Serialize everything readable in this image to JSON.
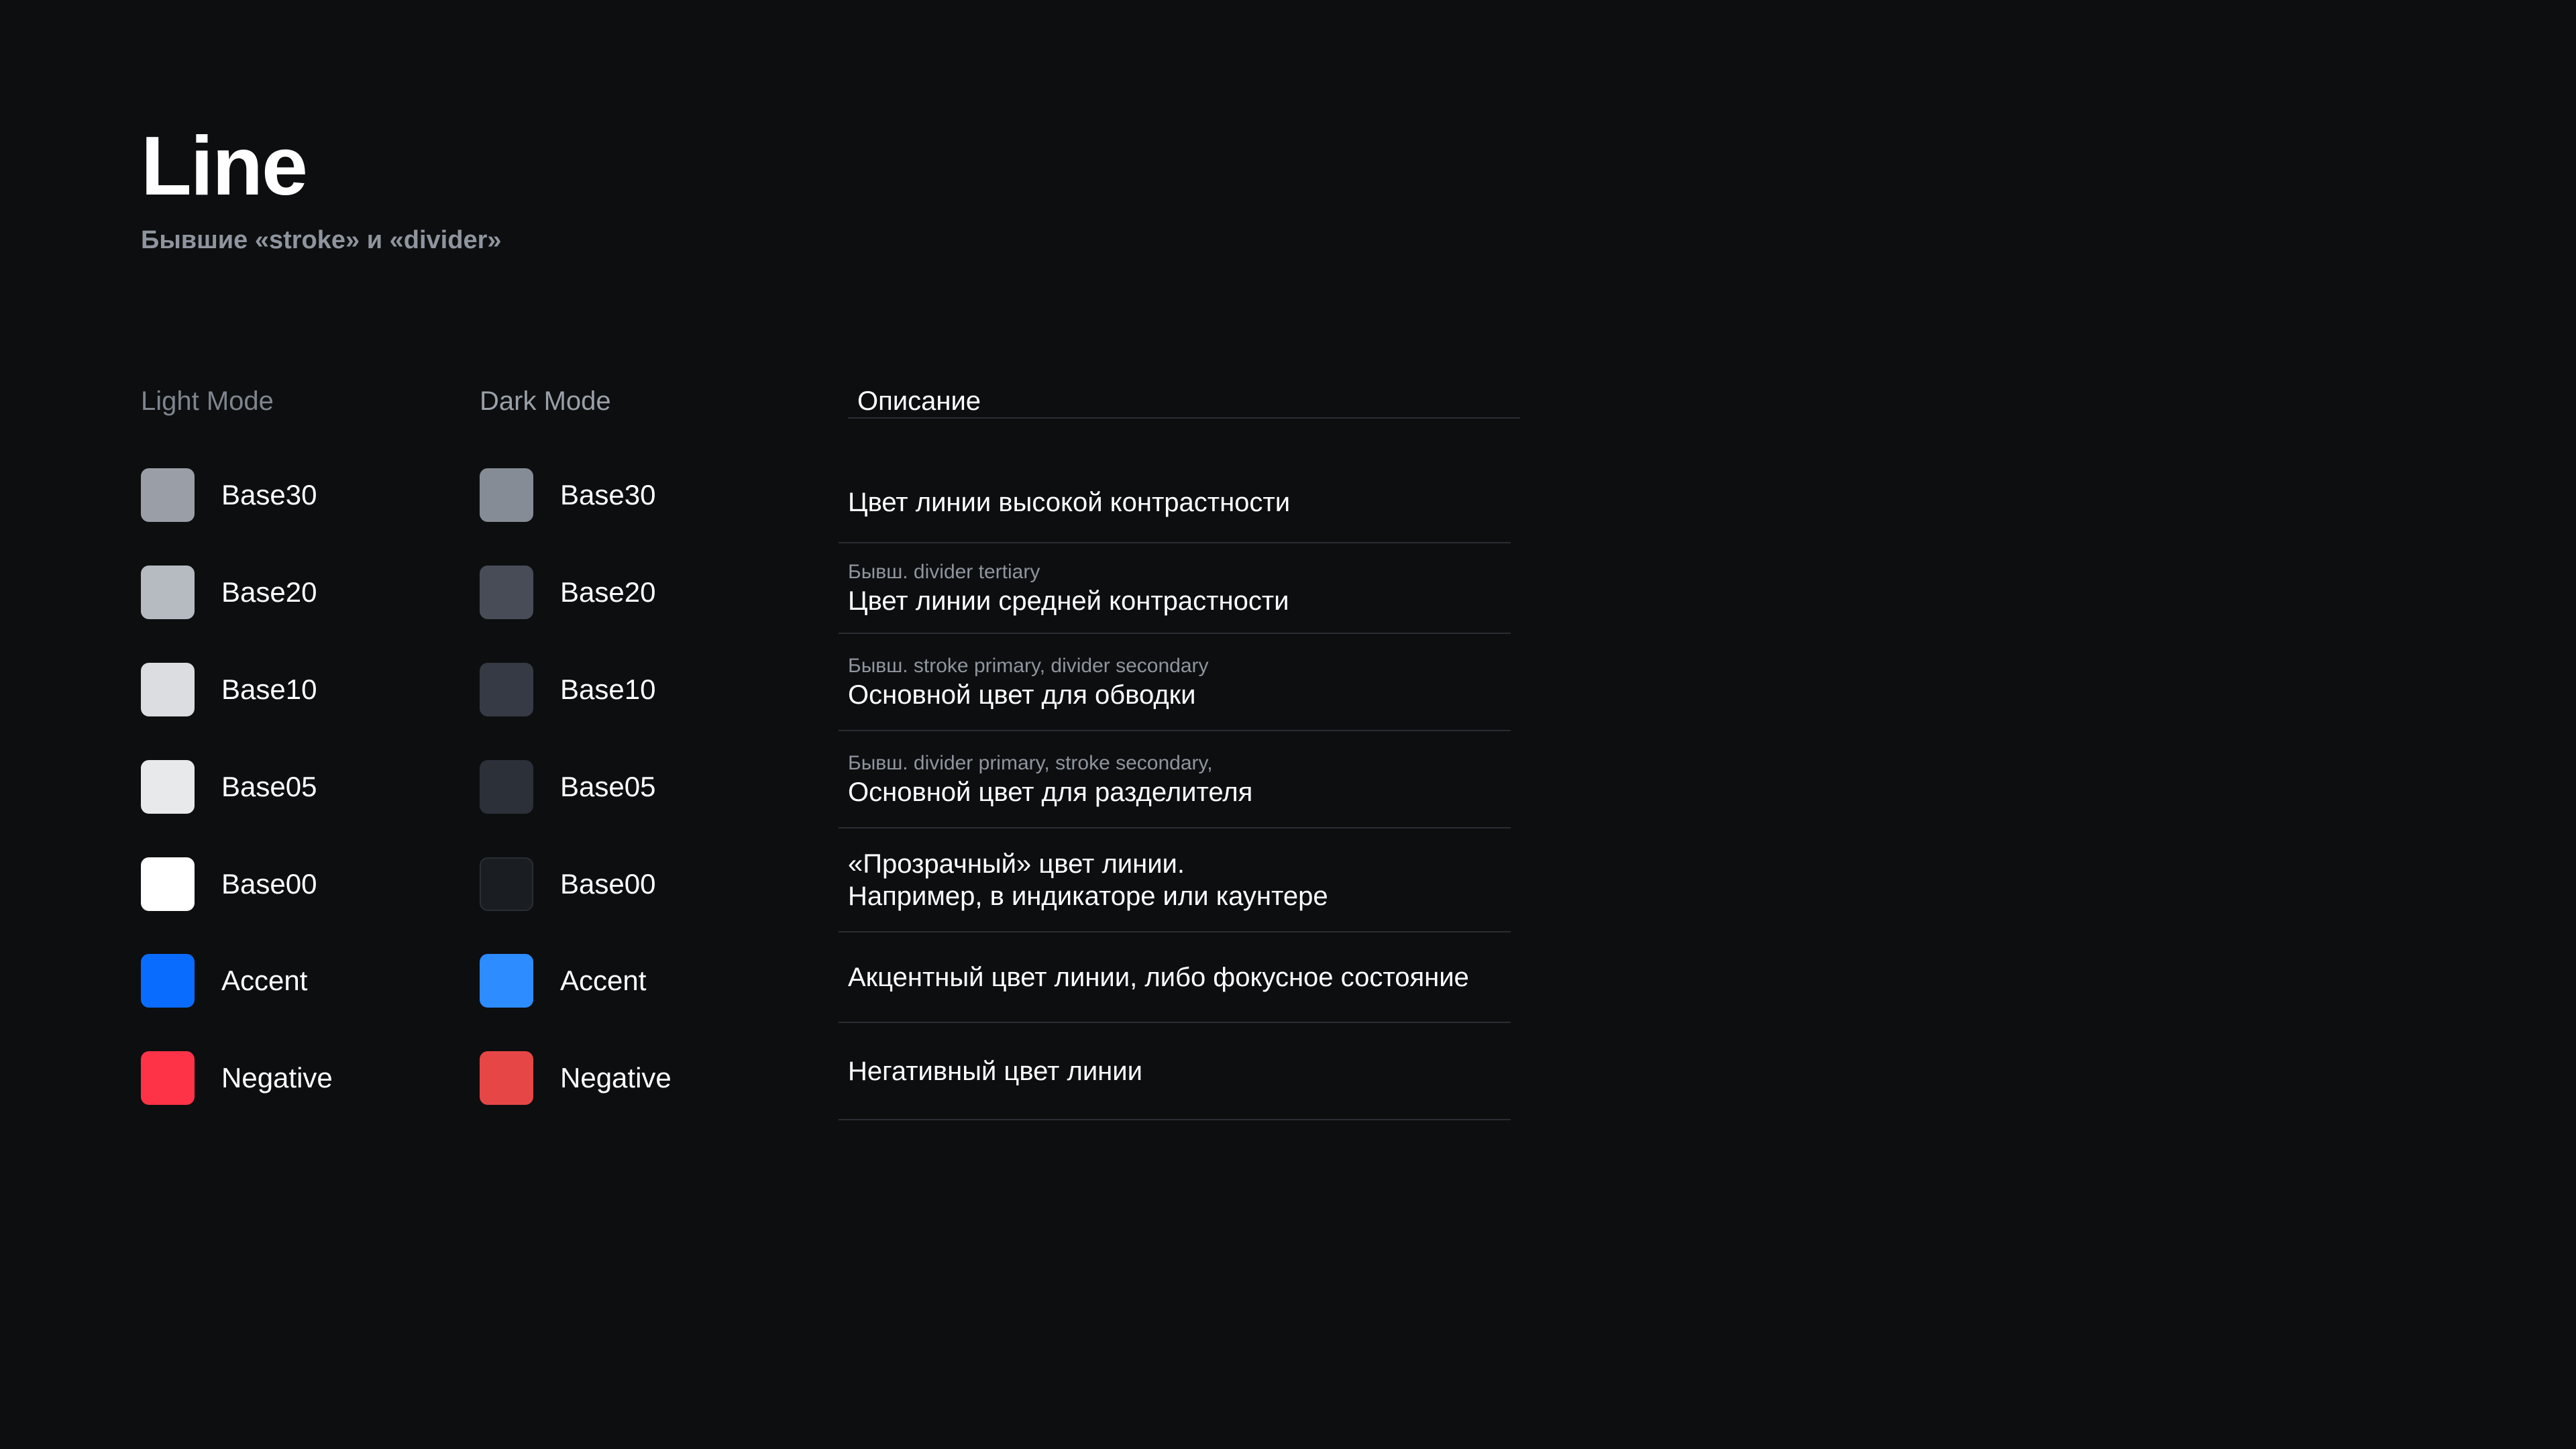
{
  "header": {
    "title": "Line",
    "subtitle": "Бывшие «stroke» и «divider»"
  },
  "columns": {
    "light": "Light Mode",
    "dark": "Dark Mode",
    "description": "Описание"
  },
  "rows": [
    {
      "light": {
        "label": "Base30",
        "color": "#9a9fa7"
      },
      "dark": {
        "label": "Base30",
        "color": "#868c95"
      },
      "former": "",
      "description": "Цвет линии высокой контрастности"
    },
    {
      "light": {
        "label": "Base20",
        "color": "#b6bbc2"
      },
      "dark": {
        "label": "Base20",
        "color": "#474c56"
      },
      "former": "Бывш. divider tertiary",
      "description": "Цвет линии средней контрастности"
    },
    {
      "light": {
        "label": "Base10",
        "color": "#dcdde0"
      },
      "dark": {
        "label": "Base10",
        "color": "#353a44"
      },
      "former": "Бывш. stroke primary, divider secondary",
      "description": "Основной цвет для обводки"
    },
    {
      "light": {
        "label": "Base05",
        "color": "#e8e9eb"
      },
      "dark": {
        "label": "Base05",
        "color": "#2c3039"
      },
      "former": "Бывш. divider primary, stroke secondary,",
      "description": "Основной цвет для разделителя"
    },
    {
      "light": {
        "label": "Base00",
        "color": "#ffffff"
      },
      "dark": {
        "label": "Base00",
        "color": "#1a1d22"
      },
      "former": "",
      "description": "«Прозрачный» цвет линии.",
      "description_2": "Например, в индикаторе или каунтере"
    },
    {
      "light": {
        "label": "Accent",
        "color": "#0a6cff"
      },
      "dark": {
        "label": "Accent",
        "color": "#2d8cff"
      },
      "former": "",
      "description": "Акцентный цвет линии, либо фокусное состояние"
    },
    {
      "light": {
        "label": "Negative",
        "color": "#ff3347"
      },
      "dark": {
        "label": "Negative",
        "color": "#e64646"
      },
      "former": "",
      "description": "Негативный цвет линии"
    }
  ]
}
